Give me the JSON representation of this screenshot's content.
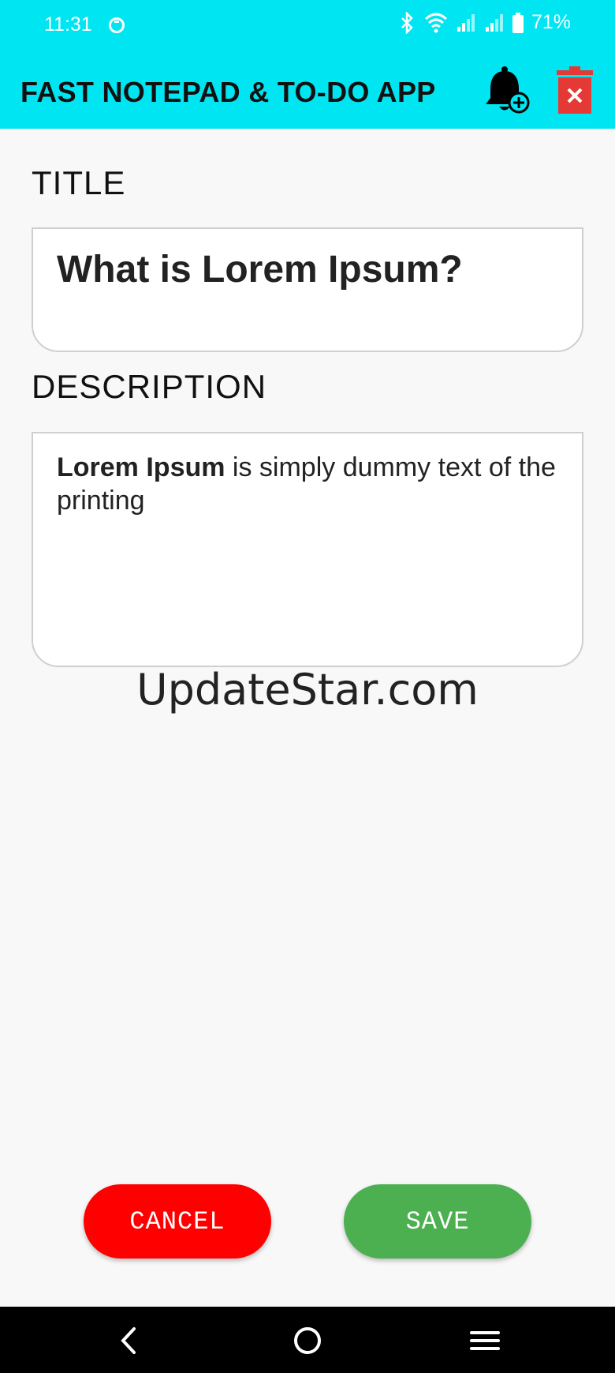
{
  "status_bar": {
    "time": "11:31",
    "battery_percent": "71%"
  },
  "app_bar": {
    "title": "FAST NOTEPAD & TO-DO APP",
    "icons": [
      "bell-plus-icon",
      "trash-close-icon"
    ]
  },
  "form": {
    "title_label": "TITLE",
    "title_value": "What is Lorem Ipsum?",
    "description_label": "DESCRIPTION",
    "description_bold": "Lorem Ipsum",
    "description_rest": " is simply dummy text of the printing"
  },
  "watermark": "UpdateStar.com",
  "buttons": {
    "cancel": "CANCEL",
    "save": "SAVE"
  },
  "colors": {
    "app_bar": "#00e5f2",
    "cancel": "#ff0000",
    "save": "#4caf50"
  }
}
